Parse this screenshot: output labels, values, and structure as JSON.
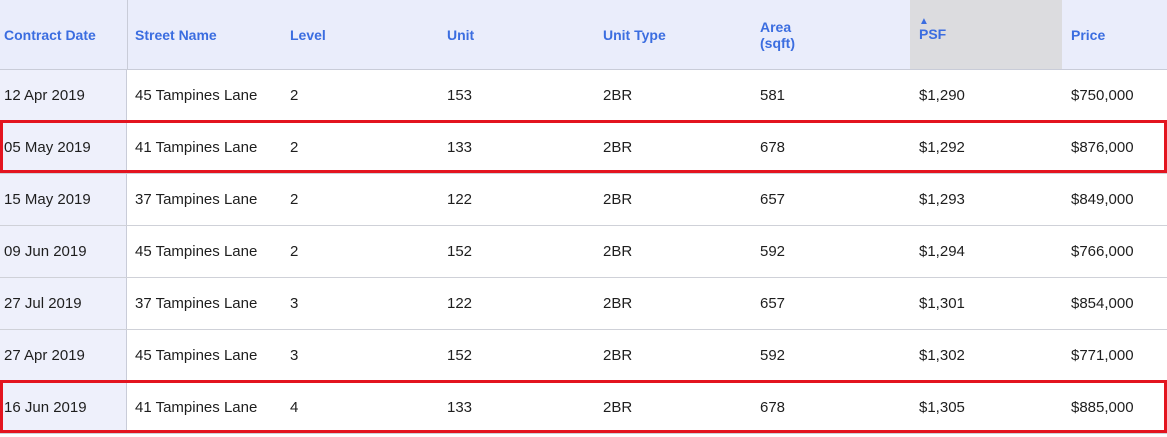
{
  "table": {
    "headers": {
      "contract_date": "Contract Date",
      "street_name": "Street Name",
      "level": "Level",
      "unit": "Unit",
      "unit_type": "Unit Type",
      "area": "Area\n(sqft)",
      "psf": "PSF",
      "price": "Price"
    },
    "sort": {
      "column": "PSF",
      "direction": "ascending",
      "arrow_icon": "sort-up-icon"
    },
    "rows": [
      [
        "12 Apr 2019",
        "45 Tampines Lane",
        "2",
        "153",
        "2BR",
        "581",
        "$1,290",
        "$750,000"
      ],
      [
        "05 May 2019",
        "41 Tampines Lane",
        "2",
        "133",
        "2BR",
        "678",
        "$1,292",
        "$876,000"
      ],
      [
        "15 May 2019",
        "37 Tampines Lane",
        "2",
        "122",
        "2BR",
        "657",
        "$1,293",
        "$849,000"
      ],
      [
        "09 Jun 2019",
        "45 Tampines Lane",
        "2",
        "152",
        "2BR",
        "592",
        "$1,294",
        "$766,000"
      ],
      [
        "27 Jul 2019",
        "37 Tampines Lane",
        "3",
        "122",
        "2BR",
        "657",
        "$1,301",
        "$854,000"
      ],
      [
        "27 Apr 2019",
        "45 Tampines Lane",
        "3",
        "152",
        "2BR",
        "592",
        "$1,302",
        "$771,000"
      ],
      [
        "16 Jun 2019",
        "41 Tampines Lane",
        "4",
        "133",
        "2BR",
        "678",
        "$1,305",
        "$885,000"
      ]
    ],
    "highlighted_rows": [
      1,
      6
    ]
  },
  "colors": {
    "header_text": "#3b6de0",
    "header_bg": "#eaedfb",
    "sorted_header_bg": "#dcdcdf",
    "highlight_border": "#e3141f"
  }
}
